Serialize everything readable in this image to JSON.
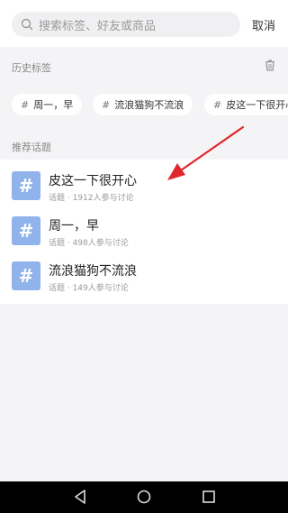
{
  "search": {
    "placeholder": "搜索标签、好友或商品",
    "cancel_label": "取消"
  },
  "history": {
    "title": "历史标签",
    "tags": [
      "周一，早",
      "流浪猫狗不流浪",
      "皮这一下很开心"
    ]
  },
  "recommended": {
    "title": "推荐话题",
    "topics": [
      {
        "icon": "#",
        "title": "皮这一下很开心",
        "meta": "话题 · 1912人参与讨论"
      },
      {
        "icon": "#",
        "title": "周一，早",
        "meta": "话题 · 498人参与讨论"
      },
      {
        "icon": "#",
        "title": "流浪猫狗不流浪",
        "meta": "话题 · 149人参与讨论"
      }
    ]
  },
  "tag_hash": "#",
  "colors": {
    "accent_topic": "#8fb3ea",
    "annotation": "#e0262b"
  },
  "icons": [
    "search-icon",
    "trash-icon",
    "back-icon",
    "home-icon",
    "recents-icon"
  ]
}
